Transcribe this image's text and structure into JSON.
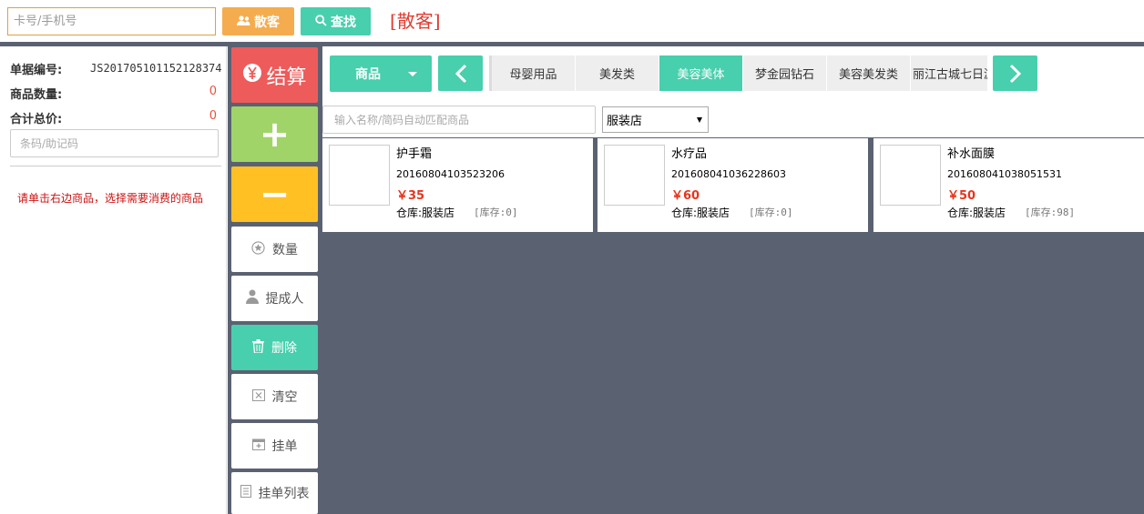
{
  "header": {
    "card_placeholder": "卡号/手机号",
    "guest_button": "散客",
    "search_button": "查找",
    "guest_label": "[散客]"
  },
  "order": {
    "number_label": "单据编号:",
    "number_value": "JS201705101152128374",
    "quantity_label": "商品数量:",
    "quantity_value": "0",
    "total_label": "合计总价:",
    "total_value": "0",
    "barcode_placeholder": "条码/助记码",
    "hint": "请单击右边商品，选择需要消费的商品"
  },
  "actions": {
    "pay": "结算",
    "plus": "+",
    "minus": "−",
    "quantity": "数量",
    "commission": "提成人",
    "delete": "删除",
    "clear": "清空",
    "hold": "挂单",
    "hold_list": "挂单列表"
  },
  "catalog": {
    "type_button": "商品",
    "categories": [
      "母婴用品",
      "美发类",
      "美容美体",
      "梦金园钻石",
      "美容美发类",
      "丽江古城七日游"
    ],
    "active_category_index": 2,
    "search_placeholder": "输入名称/简码自动匹配商品",
    "store_selected": "服装店"
  },
  "products": [
    {
      "name": "护手霜",
      "code": "20160804103523206",
      "price": "￥35",
      "warehouse": "仓库:服装店",
      "stock": "[库存:0]"
    },
    {
      "name": "水疗品",
      "code": "20160804103622860З",
      "price": "￥60",
      "warehouse": "仓库:服装店",
      "stock": "[库存:0]"
    },
    {
      "name": "补水面膜",
      "code": "20160804103805153l",
      "price": "￥50",
      "warehouse": "仓库:服装店",
      "stock": "[库存:98]"
    }
  ],
  "colors": {
    "teal": "#48cfad",
    "orange": "#f5ac4e",
    "red": "#ee5b5b",
    "green": "#a0d468",
    "yellow": "#ffc024",
    "slate": "#5a6272",
    "price_red": "#e8341c"
  }
}
